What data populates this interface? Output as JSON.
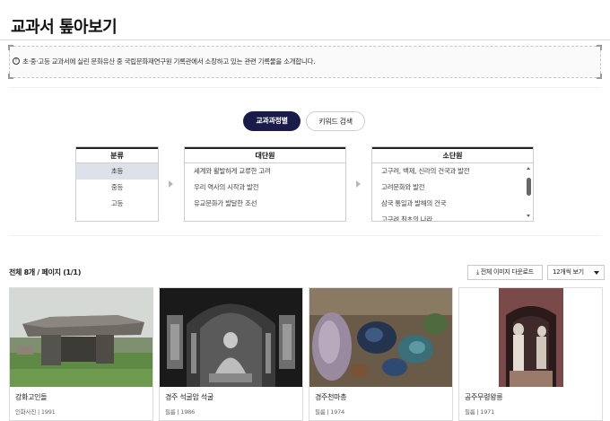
{
  "page": {
    "title": "교과서 톺아보기",
    "notice": "초·중·고등 교과서에 실린 문화유산 중 국립문화재연구원 기록관에서 소장하고 있는 관련 기록물을 소개합니다."
  },
  "tabs": [
    {
      "label": "교과과정별",
      "active": true
    },
    {
      "label": "키워드 검색",
      "active": false
    }
  ],
  "category": {
    "header": "분류",
    "items": [
      "초등",
      "중등",
      "고등"
    ],
    "selected": "초등"
  },
  "major_unit": {
    "header": "대단원",
    "items": [
      "세계와 활발하게 교류한 고려",
      "우리 역사의 시작과 발전",
      "유교문화가 발달한 조선"
    ]
  },
  "minor_unit": {
    "header": "소단원",
    "items": [
      "고구려, 백제, 신라의 건국과 발전",
      "고려문화와 발전",
      "삼국 통일과 발해의 건국",
      "고구려 최초의 나라"
    ]
  },
  "results": {
    "count_text": "전체 8개 / 페이지 (1/1)",
    "download_label": "전체 이미지 다운로드",
    "per_page_label": "12개씩 보기"
  },
  "cards": [
    {
      "title": "강화고인돌",
      "meta": "인화사진 | 1991",
      "image": "dolmen-photo"
    },
    {
      "title": "경주 석굴암 석굴",
      "meta": "필름 | 1986",
      "image": "seokguram-grotto-photo"
    },
    {
      "title": "경주천마총",
      "meta": "필름 | 1974",
      "image": "excavated-artifacts-photo"
    },
    {
      "title": "공주무령왕릉",
      "meta": "필름 | 1971",
      "image": "tomb-entrance-photo"
    }
  ],
  "icons": {
    "notice": "info-icon",
    "arrow": "chevron-right-icon",
    "download": "download-icon",
    "dropdown": "chevron-down-icon"
  },
  "colors": {
    "active_tab": "#1b1b4a",
    "selected_row": "#dde1ea"
  }
}
